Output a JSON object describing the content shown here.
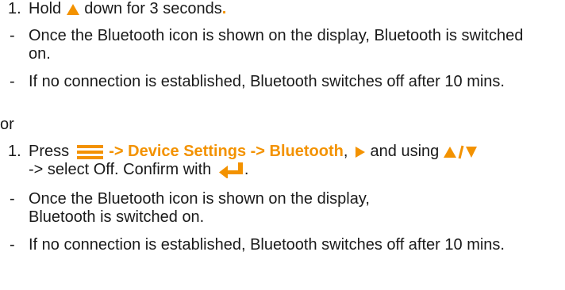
{
  "accent_color": "#f39200",
  "text_color": "#1a1a1a",
  "block1": {
    "step_number": "1.",
    "step_text_pre": "Hold ",
    "step_text_post": " down for 3 seconds",
    "step_period": ".",
    "step_icon": "up-arrow-icon",
    "bullet1_marker": "-",
    "bullet1_text": "Once the Bluetooth icon is shown on the display, Bluetooth is switched on.",
    "bullet2_marker": "-",
    "bullet2_text": "If no connection is established, Bluetooth switches off after 10 mins."
  },
  "separator": "or",
  "block2": {
    "step_number": "1.",
    "press_word": "Press",
    "menu_icon": "hamburger-menu-icon",
    "menu_path": "-> Device Settings -> Bluetooth",
    "comma": ",",
    "play_arrow_icon": "right-arrow-icon",
    "and_using": " and using ",
    "up_down_icon": "up-down-arrows-icon",
    "select_text": "-> select Off. Confirm with",
    "enter_icon": "enter-return-icon",
    "period": ".",
    "bullet1_marker": "-",
    "bullet1_line1": "Once the Bluetooth icon is shown on the display,",
    "bullet1_line2": "Bluetooth is switched on.",
    "bullet2_marker": "-",
    "bullet2_text": "If no connection is established, Bluetooth switches off after 10 mins."
  }
}
